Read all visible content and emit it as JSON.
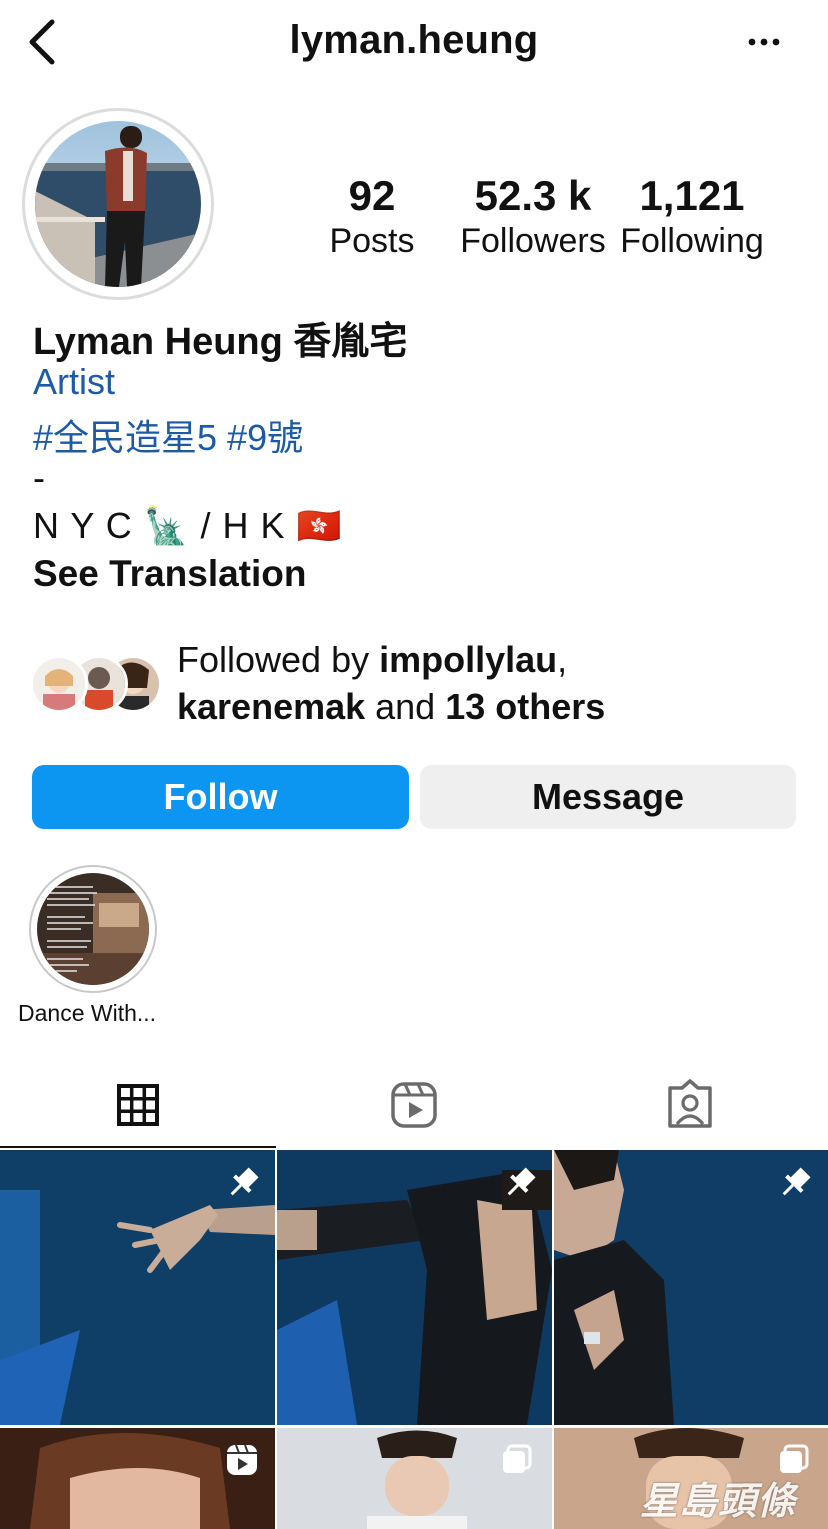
{
  "header": {
    "username": "lyman.heung"
  },
  "profile": {
    "stats": [
      {
        "value": "92",
        "label": "Posts"
      },
      {
        "value": "52.3 k",
        "label": "Followers"
      },
      {
        "value": "1,121",
        "label": "Following"
      }
    ],
    "display_name": "Lyman Heung 香胤宅",
    "category": "Artist",
    "hashtags": "#全民造星5 #9號",
    "bio_dash": "-",
    "bio_location": "N Y C 🗽 / H K 🇭🇰",
    "see_translation": "See Translation",
    "followed_by": {
      "prefix": "Followed by ",
      "user1": "impollylau",
      "comma": ",",
      "user2": "karenemak",
      "and": " and ",
      "others": "13 others"
    }
  },
  "actions": {
    "follow_label": "Follow",
    "message_label": "Message"
  },
  "highlights": [
    {
      "label": "Dance With..."
    }
  ],
  "tabs": [
    {
      "icon": "grid-icon",
      "active": true
    },
    {
      "icon": "reels-icon"
    },
    {
      "icon": "tagged-icon"
    }
  ],
  "watermark": "星島頭條",
  "colors": {
    "accent": "#0d95f2",
    "link": "#1d5aa6"
  }
}
